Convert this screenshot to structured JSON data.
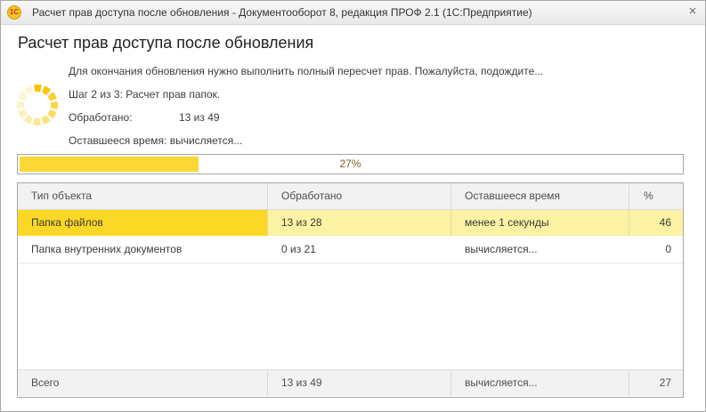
{
  "window": {
    "title": "Расчет прав доступа после обновления - Документооборот 8, редакция ПРОФ 2.1  (1С:Предприятие)",
    "app_icon": "1c-logo-icon",
    "app_icon_text": "1С",
    "close_glyph": "×"
  },
  "heading": "Расчет прав доступа после обновления",
  "info": {
    "message": "Для окончания обновления нужно выполнить полный пересчет прав. Пожалуйста, подождите...",
    "step": "Шаг 2 из 3: Расчет прав папок.",
    "processed_label": "Обработано:",
    "processed_value": "13 из 49",
    "remaining": "Оставшееся время: вычисляется..."
  },
  "progress": {
    "value": 0.27,
    "text": "27%",
    "color": "#fbd834"
  },
  "table": {
    "columns": [
      "Тип объекта",
      "Обработано",
      "Оставшееся время",
      "%"
    ],
    "rows": [
      {
        "type": "Папка файлов",
        "processed": "13 из 28",
        "remaining": "менее 1 секунды",
        "percent": "46",
        "selected": true
      },
      {
        "type": "Папка внутренних документов",
        "processed": "0 из 21",
        "remaining": "вычисляется...",
        "percent": "0",
        "selected": false
      }
    ],
    "footer": {
      "label": "Всего",
      "processed": "13 из 49",
      "remaining": "вычисляется...",
      "percent": "27"
    }
  },
  "colors": {
    "accent": "#fbd826",
    "selected_row": "#fbf2a4"
  }
}
